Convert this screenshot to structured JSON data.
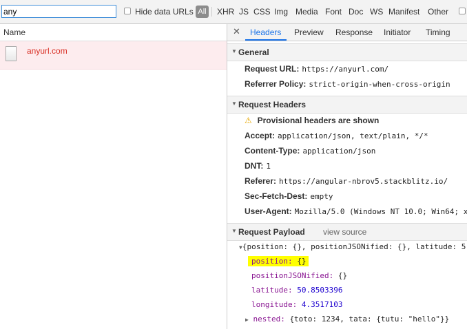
{
  "filter": {
    "value": "any",
    "hide_data_urls": "Hide data URLs",
    "all": "All",
    "types": [
      "XHR",
      "JS",
      "CSS",
      "Img",
      "Media",
      "Font",
      "Doc",
      "WS",
      "Manifest",
      "Other"
    ]
  },
  "left": {
    "column_header": "Name",
    "request": "anyurl.com"
  },
  "tabs": [
    "Headers",
    "Preview",
    "Response",
    "Initiator",
    "Timing"
  ],
  "general": {
    "title": "General",
    "rows": [
      {
        "key": "Request URL:",
        "value": "https://anyurl.com/"
      },
      {
        "key": "Referrer Policy:",
        "value": "strict-origin-when-cross-origin"
      }
    ]
  },
  "request_headers": {
    "title": "Request Headers",
    "provisional": "Provisional headers are shown",
    "rows": [
      {
        "key": "Accept:",
        "value": "application/json, text/plain, */*"
      },
      {
        "key": "Content-Type:",
        "value": "application/json"
      },
      {
        "key": "DNT:",
        "value": "1"
      },
      {
        "key": "Referer:",
        "value": "https://angular-nbrov5.stackblitz.io/"
      },
      {
        "key": "Sec-Fetch-Dest:",
        "value": "empty"
      },
      {
        "key": "User-Agent:",
        "value": "Mozilla/5.0 (Windows NT 10.0; Win64; x"
      }
    ]
  },
  "payload": {
    "title": "Request Payload",
    "view_source": "view source",
    "summary": "{position: {}, positionJSONified: {}, latitude: 5",
    "lines": [
      {
        "key": "position:",
        "value": "{}"
      },
      {
        "key": "positionJSONified:",
        "value": "{}"
      },
      {
        "key": "latitude:",
        "value": "50.8503396"
      },
      {
        "key": "longitude:",
        "value": "4.3517103"
      }
    ],
    "nested_key": "nested:",
    "nested_value": "{toto: 1234, tata: {tutu: \"hello\"}}"
  }
}
